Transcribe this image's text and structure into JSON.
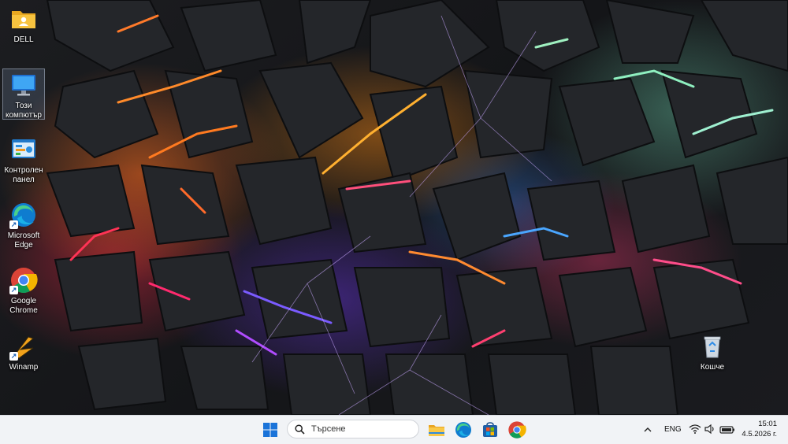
{
  "desktop": {
    "icons": [
      {
        "label": "DELL",
        "icon": "folder-icon"
      },
      {
        "label": "Този компютър",
        "icon": "monitor-icon"
      },
      {
        "label": "Контролен панел",
        "icon": "control-panel-icon"
      },
      {
        "label": "Microsoft Edge",
        "icon": "edge-icon"
      },
      {
        "label": "Google Chrome",
        "icon": "chrome-icon"
      },
      {
        "label": "Winamp",
        "icon": "winamp-icon"
      },
      {
        "label": "Кошче",
        "icon": "recycle-bin-icon"
      }
    ]
  },
  "taskbar": {
    "search_placeholder": "Търсене",
    "pinned": [
      "file-explorer-icon",
      "edge-icon",
      "store-icon",
      "chrome-icon"
    ],
    "language": "ENG",
    "time": "15:01",
    "date": "4.5.2026 г."
  }
}
